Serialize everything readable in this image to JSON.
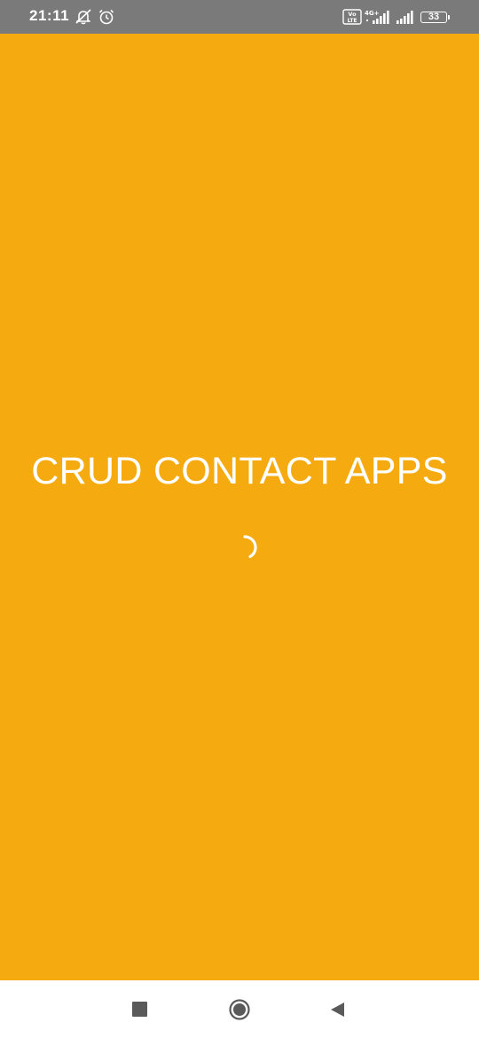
{
  "status_bar": {
    "time": "21:11",
    "icons": [
      "bell-off-icon",
      "alarm-icon",
      "volte-icon",
      "signal-4g-icon",
      "signal-icon",
      "battery-icon"
    ],
    "volte_label_top": "Vo",
    "volte_label_bottom": "LTE",
    "network_label": "4G+",
    "battery_level": "33"
  },
  "splash": {
    "title": "CRUD CONTACT APPS",
    "loading": true
  },
  "nav_bar": {
    "buttons": [
      "recents",
      "home",
      "back"
    ]
  },
  "colors": {
    "background": "#f5ab0f",
    "status_bar": "#7a7a7a",
    "text": "#ffffff",
    "nav_bar": "#ffffff",
    "nav_icons": "#5a5a5a"
  }
}
